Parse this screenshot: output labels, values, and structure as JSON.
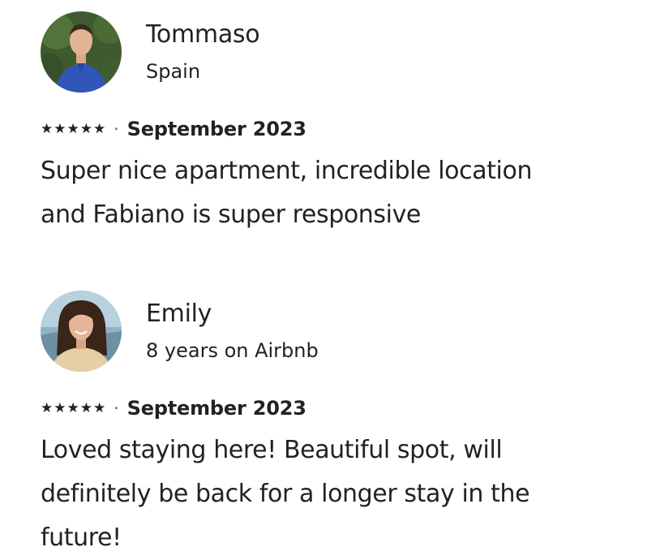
{
  "reviews": [
    {
      "name": "Tommaso",
      "subtitle": "Spain",
      "rating": 5,
      "stars": [
        "★",
        "★",
        "★",
        "★",
        "★"
      ],
      "separator": "·",
      "date": "September 2023",
      "text_lines": [
        "Super nice apartment, incredible location",
        "and Fabiano is super responsive"
      ]
    },
    {
      "name": "Emily",
      "subtitle": "8 years on Airbnb",
      "rating": 5,
      "stars": [
        "★",
        "★",
        "★",
        "★",
        "★"
      ],
      "separator": "·",
      "date": "September 2023",
      "text_lines": [
        "Loved staying here! Beautiful spot, will",
        "definitely be back for a longer stay in the",
        "future!"
      ]
    }
  ],
  "colors": {
    "text": "#222222",
    "background": "#ffffff"
  }
}
